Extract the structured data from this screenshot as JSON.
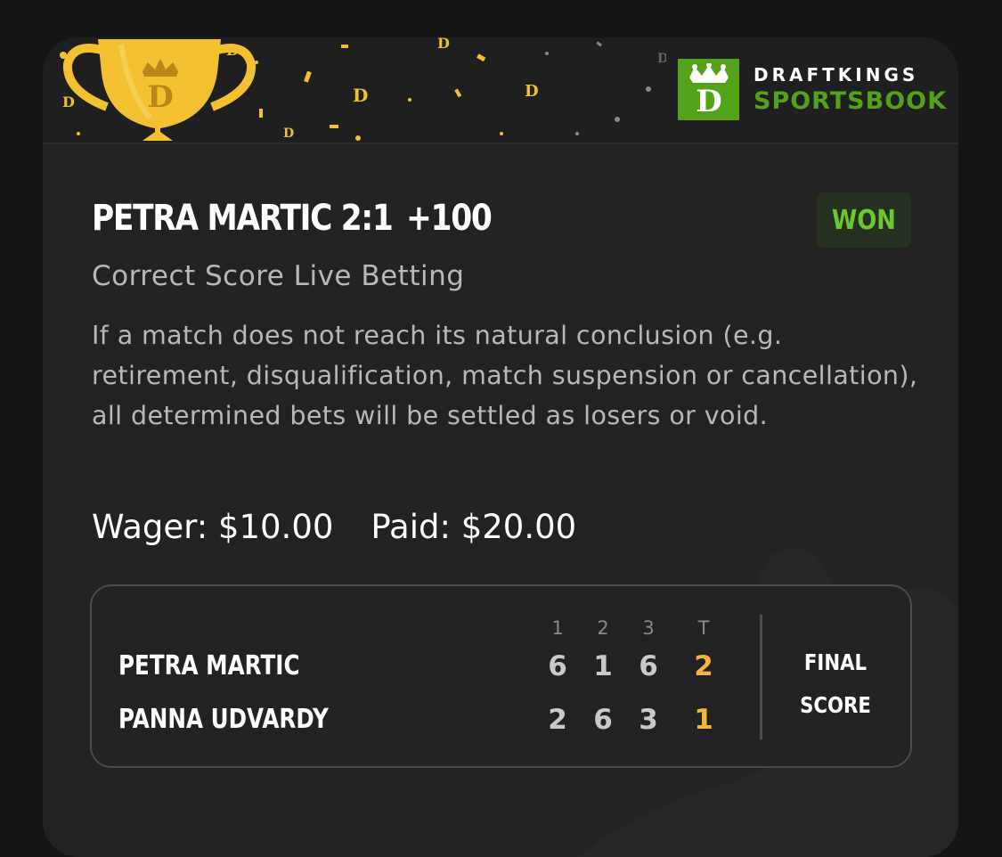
{
  "brand": {
    "line1": "DRAFTKINGS",
    "line2": "SPORTSBOOK",
    "colors": {
      "green": "#53a318",
      "gold": "#f2c030"
    }
  },
  "bet": {
    "selection": "PETRA MARTIC 2:1",
    "odds": "+100",
    "status": "WON",
    "market": "Correct Score Live Betting",
    "rules": "If a match does not reach its natural conclusion (e.g. retirement, disqualification, match suspension or cancellation), all determined bets will be settled as losers or void.",
    "wager": "Wager: $10.00",
    "paid": "Paid: $20.00"
  },
  "scoreboard": {
    "columns": [
      "1",
      "2",
      "3",
      "T"
    ],
    "players": [
      {
        "name": "PETRA MARTIC",
        "sets": [
          "6",
          "1",
          "6"
        ],
        "total": "2"
      },
      {
        "name": "PANNA UDVARDY",
        "sets": [
          "2",
          "6",
          "3"
        ],
        "total": "1"
      }
    ],
    "final_line1": "FINAL",
    "final_line2": "SCORE"
  },
  "icons": [
    "trophy-icon",
    "draftkings-crown-logo-icon",
    "confetti-decoration"
  ]
}
